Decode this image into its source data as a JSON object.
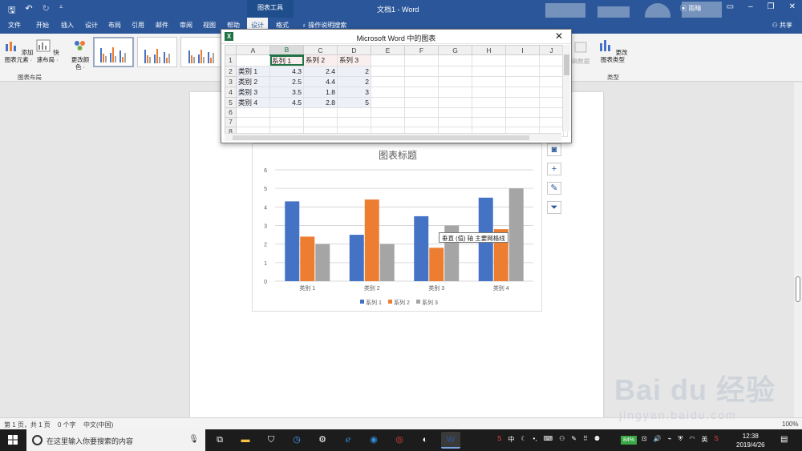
{
  "titlebar": {
    "qat_icons": [
      "save-icon",
      "undo-icon",
      "redo-icon",
      "customize-icon"
    ],
    "context_tab": "图表工具",
    "doc_title": "文档1 - Word",
    "account": "雨晴"
  },
  "tabs": [
    {
      "label": "文件",
      "active": false
    },
    {
      "label": "开始",
      "active": false
    },
    {
      "label": "插入",
      "active": false
    },
    {
      "label": "设计",
      "active": false
    },
    {
      "label": "布局",
      "active": false
    },
    {
      "label": "引用",
      "active": false
    },
    {
      "label": "邮件",
      "active": false
    },
    {
      "label": "审阅",
      "active": false
    },
    {
      "label": "视图",
      "active": false
    },
    {
      "label": "帮助",
      "active": false
    },
    {
      "label": "设计",
      "active": true
    },
    {
      "label": "格式",
      "active": false
    }
  ],
  "tell_me": "操作说明搜索",
  "share": "共享",
  "ribbon": {
    "add_element": "添加图表元素 ·",
    "quick_layout": "快速布局 ·",
    "group_layout": "图表布局",
    "change_colors": "更改颜色 ·",
    "edit_data": "辑数据",
    "change_type": "更改图表类型",
    "group_type": "类型"
  },
  "excel": {
    "title": "Microsoft Word 中的图表",
    "columns": [
      "A",
      "B",
      "C",
      "D",
      "E",
      "F",
      "G",
      "H",
      "I",
      "J"
    ],
    "rows": [
      "1",
      "2",
      "3",
      "4",
      "5",
      "6",
      "7",
      "8"
    ],
    "series_headers": [
      "系列 1",
      "系列 2",
      "系列 3"
    ],
    "categories": [
      "类别 1",
      "类别 2",
      "类别 3",
      "类别 4"
    ],
    "values": [
      [
        "4.3",
        "2.4",
        "2"
      ],
      [
        "2.5",
        "4.4",
        "2"
      ],
      [
        "3.5",
        "1.8",
        "3"
      ],
      [
        "4.5",
        "2.8",
        "5"
      ]
    ]
  },
  "chart_data": {
    "type": "bar",
    "title": "图表标题",
    "categories": [
      "类别 1",
      "类别 2",
      "类别 3",
      "类别 4"
    ],
    "series": [
      {
        "name": "系列 1",
        "color": "#4472c4",
        "values": [
          4.3,
          2.5,
          3.5,
          4.5
        ]
      },
      {
        "name": "系列 2",
        "color": "#ed7d31",
        "values": [
          2.4,
          4.4,
          1.8,
          2.8
        ]
      },
      {
        "name": "系列 3",
        "color": "#a5a5a5",
        "values": [
          2,
          2,
          3,
          5
        ]
      }
    ],
    "ylim": [
      0,
      6
    ],
    "yticks": [
      0,
      1,
      2,
      3,
      4,
      5,
      6
    ],
    "grid": true,
    "legend": "bottom"
  },
  "tooltip": "垂直 (值) 轴 主要网格线",
  "status": {
    "page": "第 1 页，共 1 页",
    "words": "0 个字",
    "lang": "中文(中国)",
    "zoom": "100%"
  },
  "taskbar": {
    "search_placeholder": "在这里输入你要搜索的内容",
    "battery": "84%",
    "ime": "中",
    "time": "12:38",
    "date": "2019/4/26"
  },
  "watermark": {
    "brand": "Bai du 经验",
    "url": "jingyan.baidu.com"
  }
}
